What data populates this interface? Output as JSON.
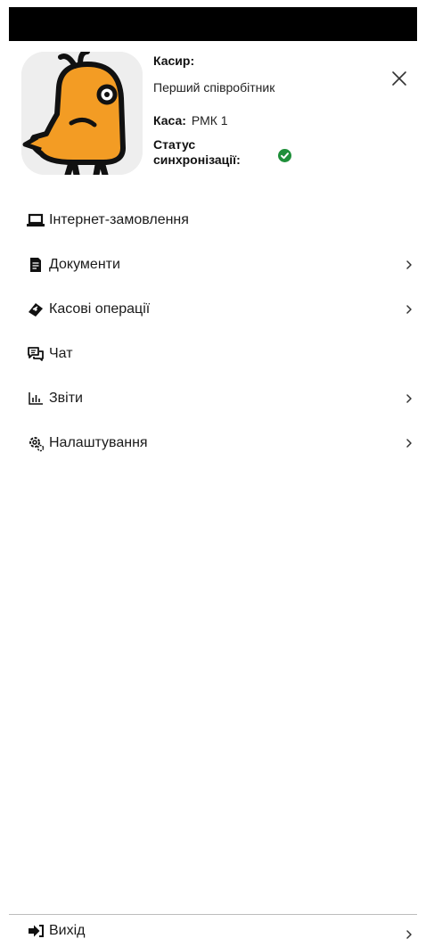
{
  "profile": {
    "cashier_label": "Касир:",
    "cashier_name": "Перший співробітник",
    "register_label": "Каса:",
    "register_value": "РМК 1",
    "sync_label": "Статус синхронізації:",
    "sync_status": "ok",
    "accent_color": "#f39c24"
  },
  "menu": {
    "items": [
      {
        "label": "Інтернет-замовлення",
        "icon": "laptop-icon",
        "has_chevron": false
      },
      {
        "label": "Документи",
        "icon": "document-icon",
        "has_chevron": true
      },
      {
        "label": "Касові операції",
        "icon": "money-icon",
        "has_chevron": true
      },
      {
        "label": "Чат",
        "icon": "chat-icon",
        "has_chevron": false
      },
      {
        "label": "Звіти",
        "icon": "chart-icon",
        "has_chevron": true
      },
      {
        "label": "Налаштування",
        "icon": "gear-icon",
        "has_chevron": true
      }
    ]
  },
  "footer": {
    "logout_label": "Вихід",
    "icon": "logout-icon"
  }
}
